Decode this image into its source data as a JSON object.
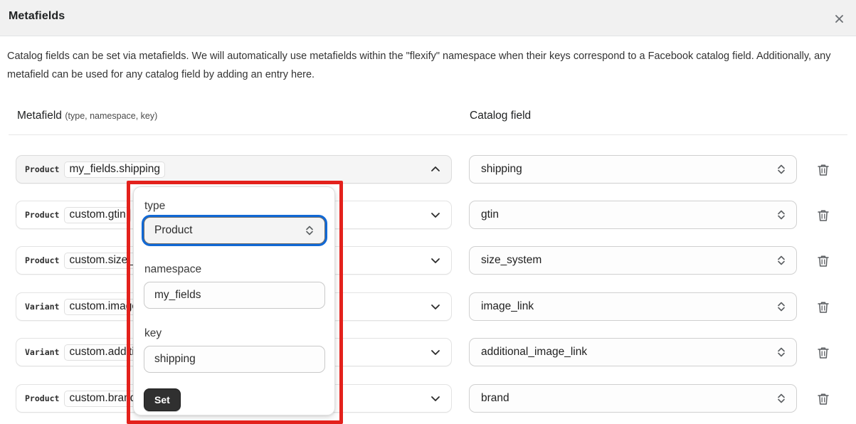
{
  "modal": {
    "title": "Metafields",
    "close_icon": "close-icon",
    "description": "Catalog fields can be set via metafields. We will automatically use metafields within the \"flexify\" namespace when their keys correspond to a Facebook catalog field. Additionally, any metafield can be used for any catalog field by adding an entry here."
  },
  "columns": {
    "metafield_main": "Metafield",
    "metafield_sub": "(type, namespace, key)",
    "catalog_field": "Catalog field"
  },
  "rows": [
    {
      "badge": "Product",
      "value": "my_fields.shipping",
      "expanded": true,
      "chevron": "chevron-up-icon",
      "catalog_field": "shipping",
      "delete_icon": "trash-icon"
    },
    {
      "badge": "Product",
      "value": "custom.gtin",
      "expanded": false,
      "chevron": "chevron-down-icon",
      "catalog_field": "gtin",
      "delete_icon": "trash-icon"
    },
    {
      "badge": "Product",
      "value": "custom.size_system",
      "expanded": false,
      "chevron": "chevron-down-icon",
      "catalog_field": "size_system",
      "delete_icon": "trash-icon"
    },
    {
      "badge": "Variant",
      "value": "custom.image_link",
      "expanded": false,
      "chevron": "chevron-down-icon",
      "catalog_field": "image_link",
      "delete_icon": "trash-icon"
    },
    {
      "badge": "Variant",
      "value": "custom.additional_image_link",
      "expanded": false,
      "chevron": "chevron-down-icon",
      "catalog_field": "additional_image_link",
      "delete_icon": "trash-icon"
    },
    {
      "badge": "Product",
      "value": "custom.brand",
      "expanded": false,
      "chevron": "chevron-down-icon",
      "catalog_field": "brand",
      "delete_icon": "trash-icon"
    }
  ],
  "popover": {
    "type_label": "type",
    "type_value": "Product",
    "namespace_label": "namespace",
    "namespace_value": "my_fields",
    "key_label": "key",
    "key_value": "shipping",
    "set_label": "Set"
  },
  "colors": {
    "highlight_box": "#e3211c",
    "focus_ring": "#1169d6",
    "header_bg": "#f1f1f1",
    "set_button_bg": "#303030"
  }
}
